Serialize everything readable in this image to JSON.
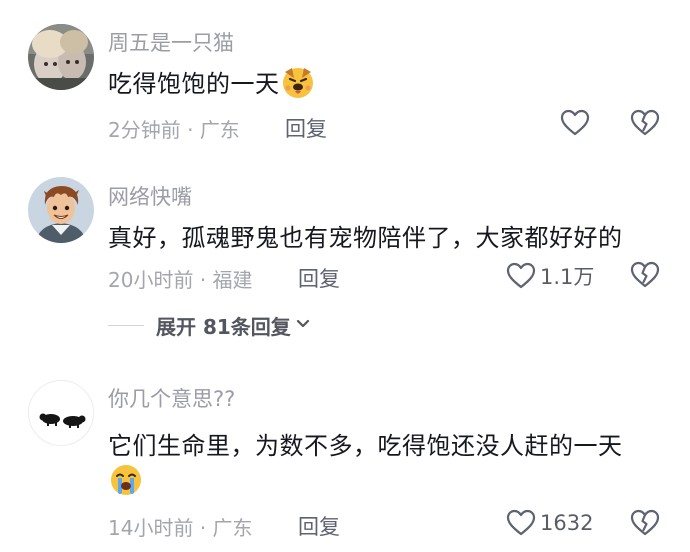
{
  "comments": [
    {
      "username": "周五是一只猫",
      "content": "吃得饱饱的一天",
      "emoji": "dog-face-emoji",
      "time": "2分钟前",
      "location": "广东",
      "reply_label": "回复",
      "likes": ""
    },
    {
      "username": "网络快嘴",
      "content": "真好，孤魂野鬼也有宠物陪伴了，大家都好好的",
      "time": "20小时前",
      "location": "福建",
      "reply_label": "回复",
      "likes": "1.1万"
    },
    {
      "username": "你几个意思??",
      "content": "它们生命里，为数不多，吃得饱还没人赶的一天",
      "emoji": "loudly-crying-face-emoji",
      "time": "14小时前",
      "location": "广东",
      "reply_label": "回复",
      "likes": "1632"
    }
  ],
  "expand_replies": "展开 81条回复",
  "meta_separator": "·",
  "colors": {
    "username": "#9a9ca6",
    "content": "#16181f",
    "meta": "#a4a6ae",
    "icon": "#5f6270"
  }
}
